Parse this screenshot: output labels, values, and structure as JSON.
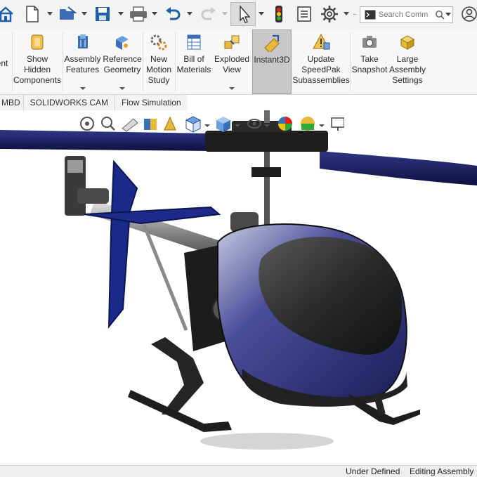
{
  "toolbar": {
    "search_placeholder": "Search Comm",
    "icons": [
      "home-icon",
      "new-document-icon",
      "open-folder-icon",
      "save-icon",
      "print-icon",
      "undo-icon",
      "redo-icon",
      "select-pointer-icon",
      "rebuild-traffic-light-icon",
      "file-properties-icon",
      "options-gear-icon",
      "command-search-icon",
      "user-account-icon"
    ]
  },
  "ribbon": {
    "items": [
      {
        "label": "ent"
      },
      {
        "label": "Show\nHidden\nComponents"
      },
      {
        "label": "Assembly\nFeatures"
      },
      {
        "label": "Reference\nGeometry"
      },
      {
        "label": "New\nMotion\nStudy"
      },
      {
        "label": "Bill of\nMaterials"
      },
      {
        "label": "Exploded\nView"
      },
      {
        "label": "Instant3D"
      },
      {
        "label": "Update\nSpeedPak\nSubassemblies"
      },
      {
        "label": "Take\nSnapshot"
      },
      {
        "label": "Large\nAssembly\nSettings"
      }
    ]
  },
  "tabs": [
    {
      "label": "MBD"
    },
    {
      "label": "SOLIDWORKS CAM"
    },
    {
      "label": "Flow Simulation"
    }
  ],
  "status": {
    "state": "Under Defined",
    "mode": "Editing Assembly"
  },
  "colors": {
    "body_blue": "#2b2f7a",
    "rotor_blue": "#141a55",
    "frame_dark": "#1c1c1c"
  }
}
